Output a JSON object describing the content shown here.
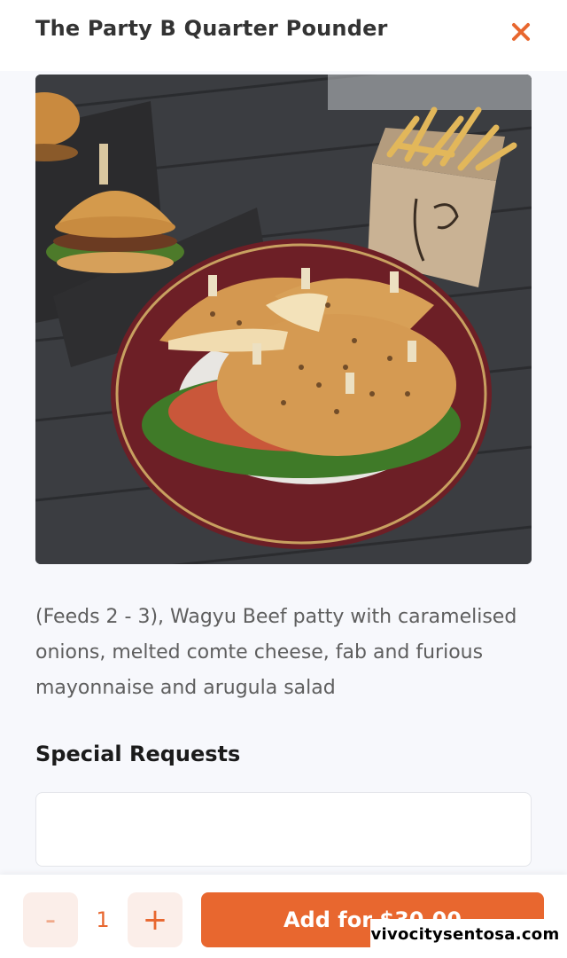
{
  "header": {
    "title": "The Party B Quarter Pounder",
    "close_icon": "close-icon"
  },
  "product": {
    "image_icon": "food-photo",
    "description": "(Feeds 2 - 3), Wagyu Beef patty with caramelised onions, melted comte cheese, fab and furious mayonnaise and arugula salad"
  },
  "special_requests": {
    "title": "Special Requests",
    "value": "",
    "placeholder": ""
  },
  "footer": {
    "minus_label": "-",
    "quantity": "1",
    "plus_label": "+",
    "add_label": "Add for $30.00"
  },
  "watermark": "vivocitysentosa.com",
  "colors": {
    "accent": "#e8672f",
    "accent_light": "#fbeee9",
    "background": "#f7f8fc"
  }
}
